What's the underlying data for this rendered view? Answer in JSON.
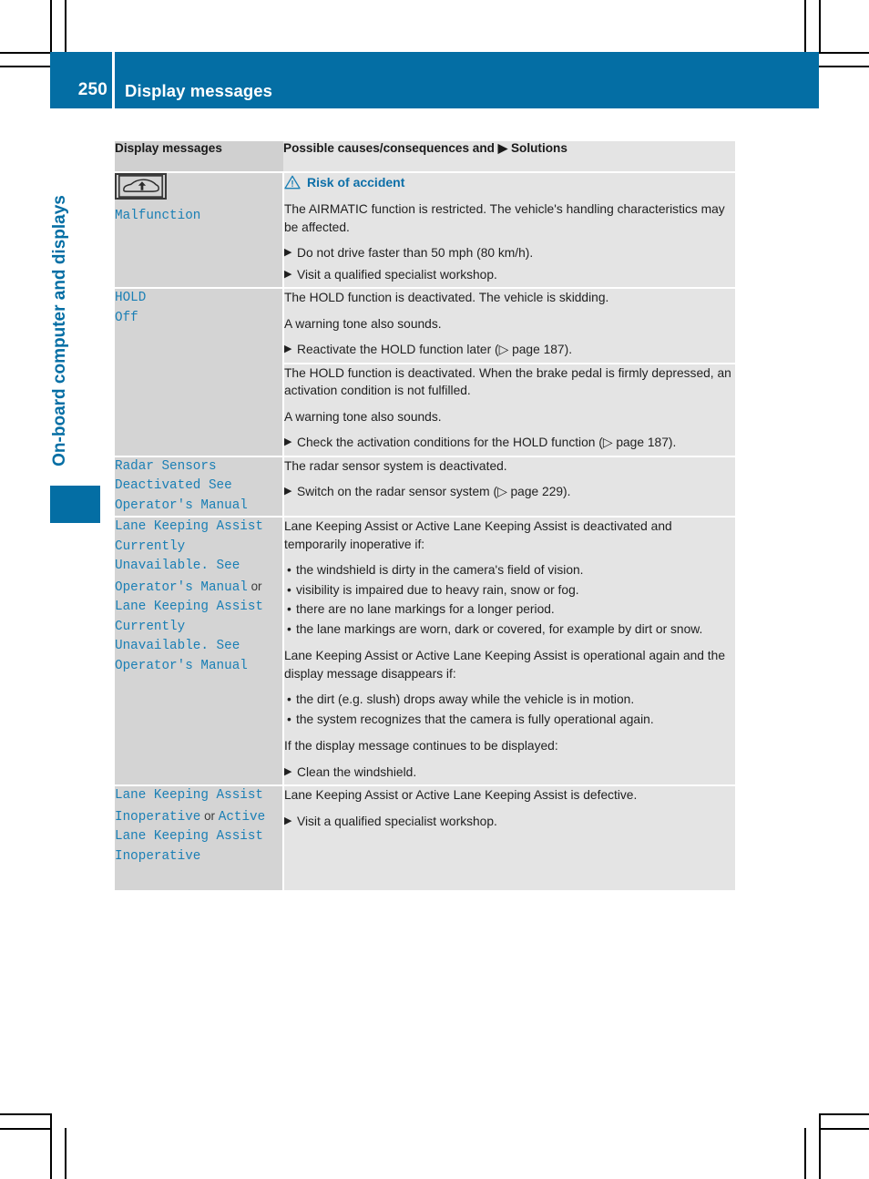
{
  "page": {
    "number": "250",
    "title": "Display messages",
    "chapter_tab": "On-board computer and displays"
  },
  "table": {
    "headers": {
      "left": "Display messages",
      "right_pre": "Possible causes/consequences and ",
      "right_post": " Solutions"
    },
    "rows": [
      {
        "id": "airmatic-malfunction",
        "icon": "car-suspension-up-icon",
        "message": "Malfunction",
        "warning": {
          "icon": "warning-triangle-icon",
          "title": "Risk of accident"
        },
        "paragraphs": [
          "The AIRMATIC function is restricted. The vehicle's handling characteristics may be affected."
        ],
        "steps": [
          "Do not drive faster than 50 mph (80 km/h).",
          "Visit a qualified specialist workshop."
        ]
      },
      {
        "id": "hold-off-skidding",
        "message_lines": [
          "HOLD",
          "Off"
        ],
        "paragraphs": [
          "The HOLD function is deactivated. The vehicle is skidding.",
          "A warning tone also sounds."
        ],
        "steps": [
          "Reactivate the HOLD function later (▷ page 187)."
        ]
      },
      {
        "id": "hold-off-activation-condition",
        "message_lines": [],
        "paragraphs": [
          "The HOLD function is deactivated. When the brake pedal is firmly depressed, an activation condition is not fulfilled.",
          "A warning tone also sounds."
        ],
        "steps": [
          "Check the activation conditions for the HOLD function (▷ page 187)."
        ]
      },
      {
        "id": "radar-sensors-deactivated",
        "message": "Radar Sensors Deactivated See Operator's Manual",
        "paragraphs": [
          "The radar sensor system is deactivated."
        ],
        "steps": [
          "Switch on the radar sensor system (▷ page 229)."
        ]
      },
      {
        "id": "lane-keeping-assist-unavailable",
        "message_a": "Lane Keeping Assist Currently Unavailable. See Operator's Manual",
        "conjunction": "or",
        "message_b": "Lane Keeping Assist Currently Unavailable. See Operator's Manual",
        "paragraphs_1": [
          "Lane Keeping Assist or Active Lane Keeping Assist is deactivated and temporarily inoperative if:"
        ],
        "bullets_1": [
          "the windshield is dirty in the camera's field of vision.",
          "visibility is impaired due to heavy rain, snow or fog.",
          "there are no lane markings for a longer period.",
          "the lane markings are worn, dark or covered, for example by dirt or snow."
        ],
        "paragraphs_2": [
          "Lane Keeping Assist or Active Lane Keeping Assist is operational again and the display message disappears if:"
        ],
        "bullets_2": [
          "the dirt (e.g. slush) drops away while the vehicle is in motion.",
          "the system recognizes that the camera is fully operational again."
        ],
        "paragraphs_3": [
          "If the display message continues to be displayed:"
        ],
        "steps": [
          "Clean the windshield."
        ]
      },
      {
        "id": "lane-keeping-assist-inoperative",
        "message_a": "Lane Keeping Assist Inoperative",
        "conjunction": "or",
        "message_b": "Active Lane Keeping Assist Inoperative",
        "paragraphs": [
          "Lane Keeping Assist or Active Lane Keeping Assist is defective."
        ],
        "steps": [
          "Visit a qualified specialist workshop."
        ]
      }
    ]
  },
  "colors": {
    "brand_blue": "#046ea4",
    "message_blue": "#1a7fb5",
    "header_gray": "#d0d0d0",
    "left_cell_gray": "#d4d4d4",
    "right_cell_gray": "#e4e4e4"
  }
}
